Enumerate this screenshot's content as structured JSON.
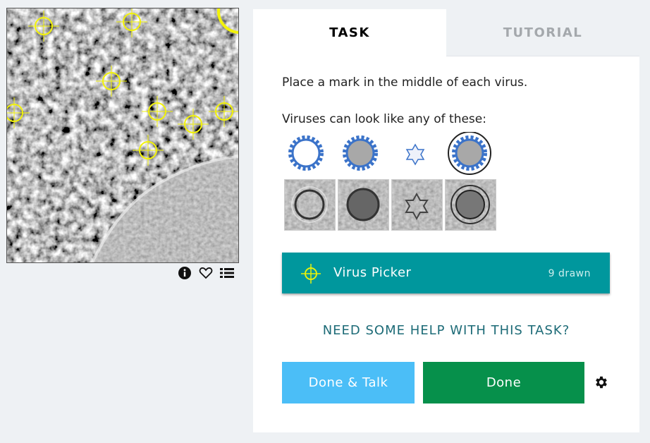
{
  "subject": {
    "image_name": "cryo-em-tomogram",
    "marks_icon": "virus-crosshair-icon"
  },
  "meta_icons": [
    "info-icon",
    "heart-icon",
    "collections-list-icon"
  ],
  "tabs": [
    {
      "label": "TASK",
      "active": true
    },
    {
      "label": "TUTORIAL",
      "active": false
    }
  ],
  "task": {
    "instruction": "Place a mark in the middle of each virus.",
    "examples_label": "Viruses can look like any of these:",
    "diagram_icons": [
      "empty-capsid-icon",
      "full-capsid-icon",
      "star-particle-icon",
      "enveloped-capsid-icon"
    ],
    "photo_examples": [
      "empty-virus-photo",
      "full-virus-photo",
      "star-virus-photo",
      "enveloped-virus-photo"
    ]
  },
  "tool": {
    "label": "Virus Picker",
    "count_label": "9 drawn",
    "icon": "crosshair-icon",
    "color": "#00979d",
    "icon_color": "#e6f20c"
  },
  "help": {
    "label": "NEED SOME HELP WITH THIS TASK?"
  },
  "buttons": {
    "done_talk": "Done & Talk",
    "done": "Done",
    "done_talk_color": "#4bbef7",
    "done_color": "#06904b"
  },
  "settings_icon": "gear-icon"
}
